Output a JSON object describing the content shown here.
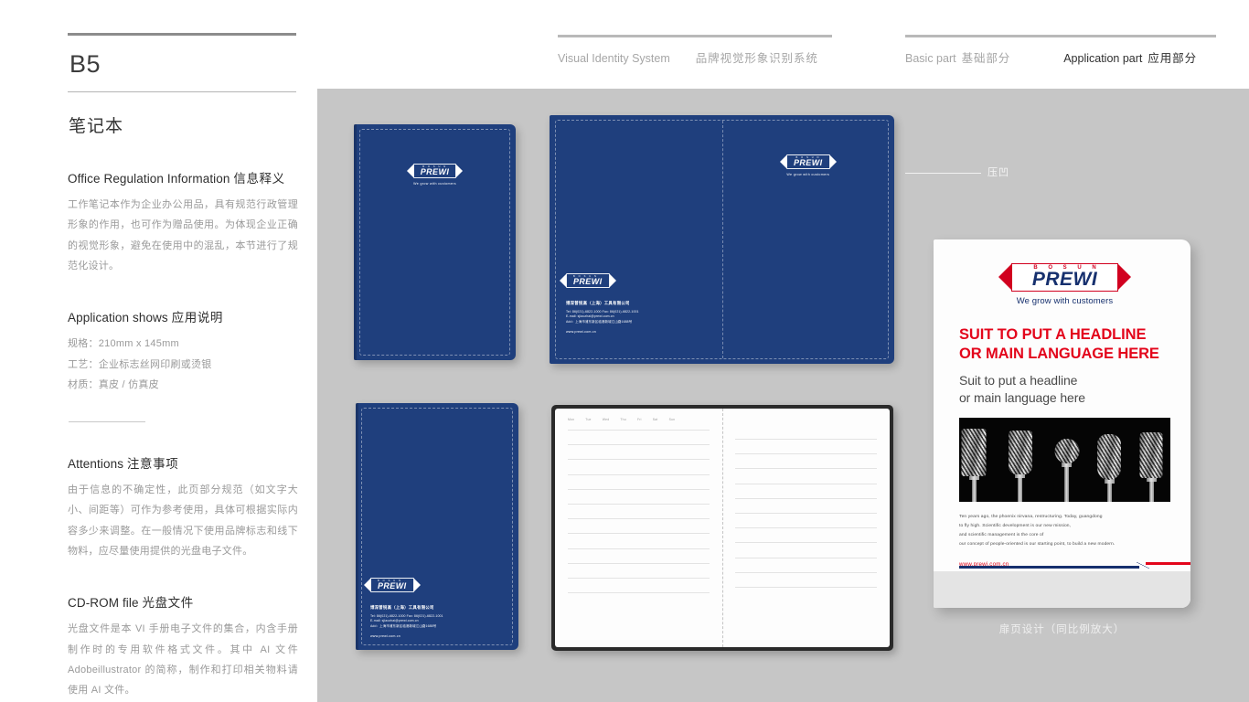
{
  "page": {
    "code": "B5",
    "section_title": "笔记本"
  },
  "header": {
    "group1": [
      {
        "en": "Visual Identity System",
        "cn": "品牌视觉形象识别系统"
      }
    ],
    "group2": [
      {
        "en": "Basic part",
        "cn": "基础部分",
        "active": false
      },
      {
        "en": "Application part",
        "cn": "应用部分",
        "active": true
      }
    ]
  },
  "sections": [
    {
      "heading_en": "Office Regulation Information",
      "heading_cn": "信息释义",
      "body": "工作笔记本作为企业办公用品，具有规范行政管理形象的作用，也可作为赠品使用。为体现企业正确的视觉形象，避免在使用中的混乱，本节进行了规范化设计。"
    },
    {
      "heading_en": "Application shows",
      "heading_cn": "应用说明",
      "specs": [
        "规格：210mm x 145mm",
        "工艺：企业标志丝网印刷或烫银",
        "材质：真皮 / 仿真皮"
      ]
    },
    {
      "heading_en": "Attentions",
      "heading_cn": "注意事项",
      "body": "由于信息的不确定性，此页部分规范（如文字大小、间距等）可作为参考使用，具体可根据实际内容多少来调整。在一般情况下使用品牌标志和线下物料，应尽量使用提供的光盘电子文件。"
    },
    {
      "heading_en": "CD-ROM file",
      "heading_cn": "光盘文件",
      "body": "光盘文件是本 VI 手册电子文件的集合，内含手册制作时的专用软件格式文件。其中 AI 文件 Adobeillustrator 的简称，制作和打印相关物料请使用 AI 文件。"
    }
  ],
  "logo": {
    "top_text": "B O S U N",
    "wordmark": "PREWI",
    "tagline": "We grow with customers",
    "navy": "#16306e",
    "red": "#d1001f"
  },
  "contact": {
    "company": "博深普锐高（上海）工具有限公司",
    "line1": "Tel: 86(021)-6822-1000    Fax: 86(021)-6822-1001",
    "line2": "E-mail: sjiaozhai@prewi.com.cn",
    "line3": "Add：上海市浦东新区临港新城江山路1688号",
    "web": "www.prewi.com.cn"
  },
  "callout": {
    "label": "压凹"
  },
  "notebook_pages": {
    "weekdays": [
      "Mon",
      "Tue",
      "Wed",
      "Thu",
      "Fri",
      "Sat",
      "Sun"
    ],
    "rule_count_left": 12,
    "rule_count_right": 11
  },
  "flyer": {
    "headline": "SUIT TO PUT A HEADLINE OR MAIN LANGUAGE HERE",
    "subhead_line1": "Suit to put a headline",
    "subhead_line2": "or main language here",
    "body_lines": [
      "Ten years ago, the phoenix nirvana, restructuring. Today, guangdong",
      "to fly high. Scientific development is our new mission,",
      "and scientific management is the core of",
      "our concept of people-oriented is our starting point, to build a new modern."
    ],
    "url": "www.prewi.com.cn",
    "photo_alt": "carbide-burr-cutting-tools",
    "caption": "扉页设计（同比例放大）",
    "headline_color": "#e3051b",
    "bar_navy": "#16306e",
    "bar_red": "#e3051b"
  },
  "theme": {
    "stage_bg": "#c6c6c6",
    "cover_navy": "#1f3f7d",
    "page_bg": "#ffffff"
  }
}
